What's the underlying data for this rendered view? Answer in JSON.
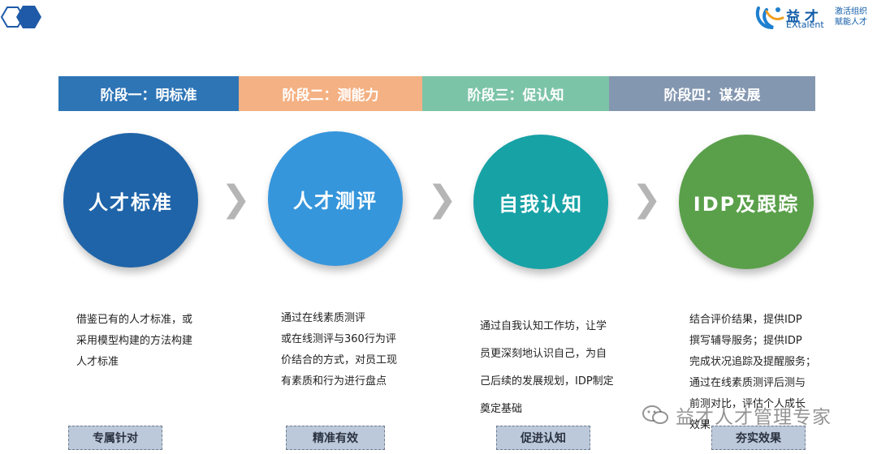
{
  "brand": {
    "logo_text": "益 才",
    "logo_sub": "EXtalent",
    "slogan_line1": "激活组织",
    "slogan_line2": "赋能人才"
  },
  "stages": [
    {
      "label": "阶段一：明标准",
      "color": "#2e75b6"
    },
    {
      "label": "阶段二：测能力",
      "color": "#f4b183"
    },
    {
      "label": "阶段三：促认知",
      "color": "#7cc4a8"
    },
    {
      "label": "阶段四：谋发展",
      "color": "#8497b0"
    }
  ],
  "circles": [
    {
      "label": "人才标准",
      "color": "#1f64a8"
    },
    {
      "label": "人才测评",
      "color": "#3696dc"
    },
    {
      "label": "自我认知",
      "color": "#17a2a6"
    },
    {
      "label": "IDP及跟踪",
      "color": "#5aa04a"
    }
  ],
  "arrow_glyph": "❯",
  "descriptions": [
    [
      "借鉴已有的人才标准，或",
      "采用模型构建的方法构建",
      "人才标准"
    ],
    [
      "通过在线素质测评",
      "或在线测评与360行为评",
      "价结合的方式，对员工现",
      "有素质和行为进行盘点"
    ],
    [
      "通过自我认知工作坊，让学",
      "员更深刻地认识自己，为自",
      "己后续的发展规划，IDP制定",
      "奠定基础"
    ],
    [
      "结合评价结果，提供IDP",
      "撰写辅导服务；提供IDP",
      "完成状况追踪及提醒服务；",
      "通过在线素质测评后测与",
      "前测对比，评估个人成长",
      "效果"
    ]
  ],
  "tags": [
    "专属针对",
    "精准有效",
    "促进认知",
    "夯实效果"
  ],
  "watermark": {
    "text": "益才人才管理专家"
  }
}
